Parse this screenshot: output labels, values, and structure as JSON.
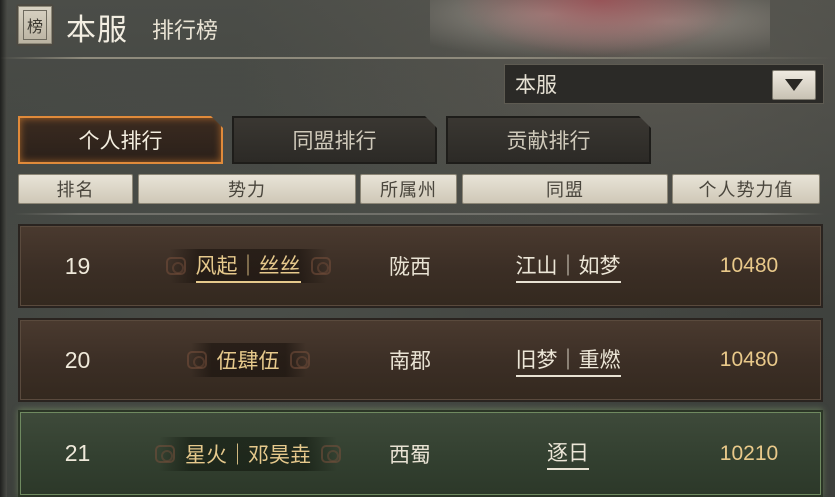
{
  "header": {
    "badge": "榜",
    "title": "本服",
    "subtitle": "排行榜"
  },
  "server_select": {
    "value": "本服"
  },
  "tabs": [
    {
      "label": "个人排行",
      "active": true
    },
    {
      "label": "同盟排行",
      "active": false
    },
    {
      "label": "贡献排行",
      "active": false
    }
  ],
  "columns": [
    "排名",
    "势力",
    "所属州",
    "同盟",
    "个人势力值"
  ],
  "rows": [
    {
      "rank": "19",
      "force": "风起｜丝丝",
      "state": "陇西",
      "alliance": "江山｜如梦",
      "power": "10480"
    },
    {
      "rank": "20",
      "force": "伍肆伍",
      "state": "南郡",
      "alliance": "旧梦｜重燃",
      "power": "10480"
    },
    {
      "rank": "21",
      "force": "星火｜邓昊垚",
      "state": "西蜀",
      "alliance": "逐日",
      "power": "10210",
      "highlighted": true
    }
  ],
  "colors": {
    "active_tab_border": "#e08a3a",
    "power_text": "#e9c98a",
    "highlight_row": "#334030"
  }
}
